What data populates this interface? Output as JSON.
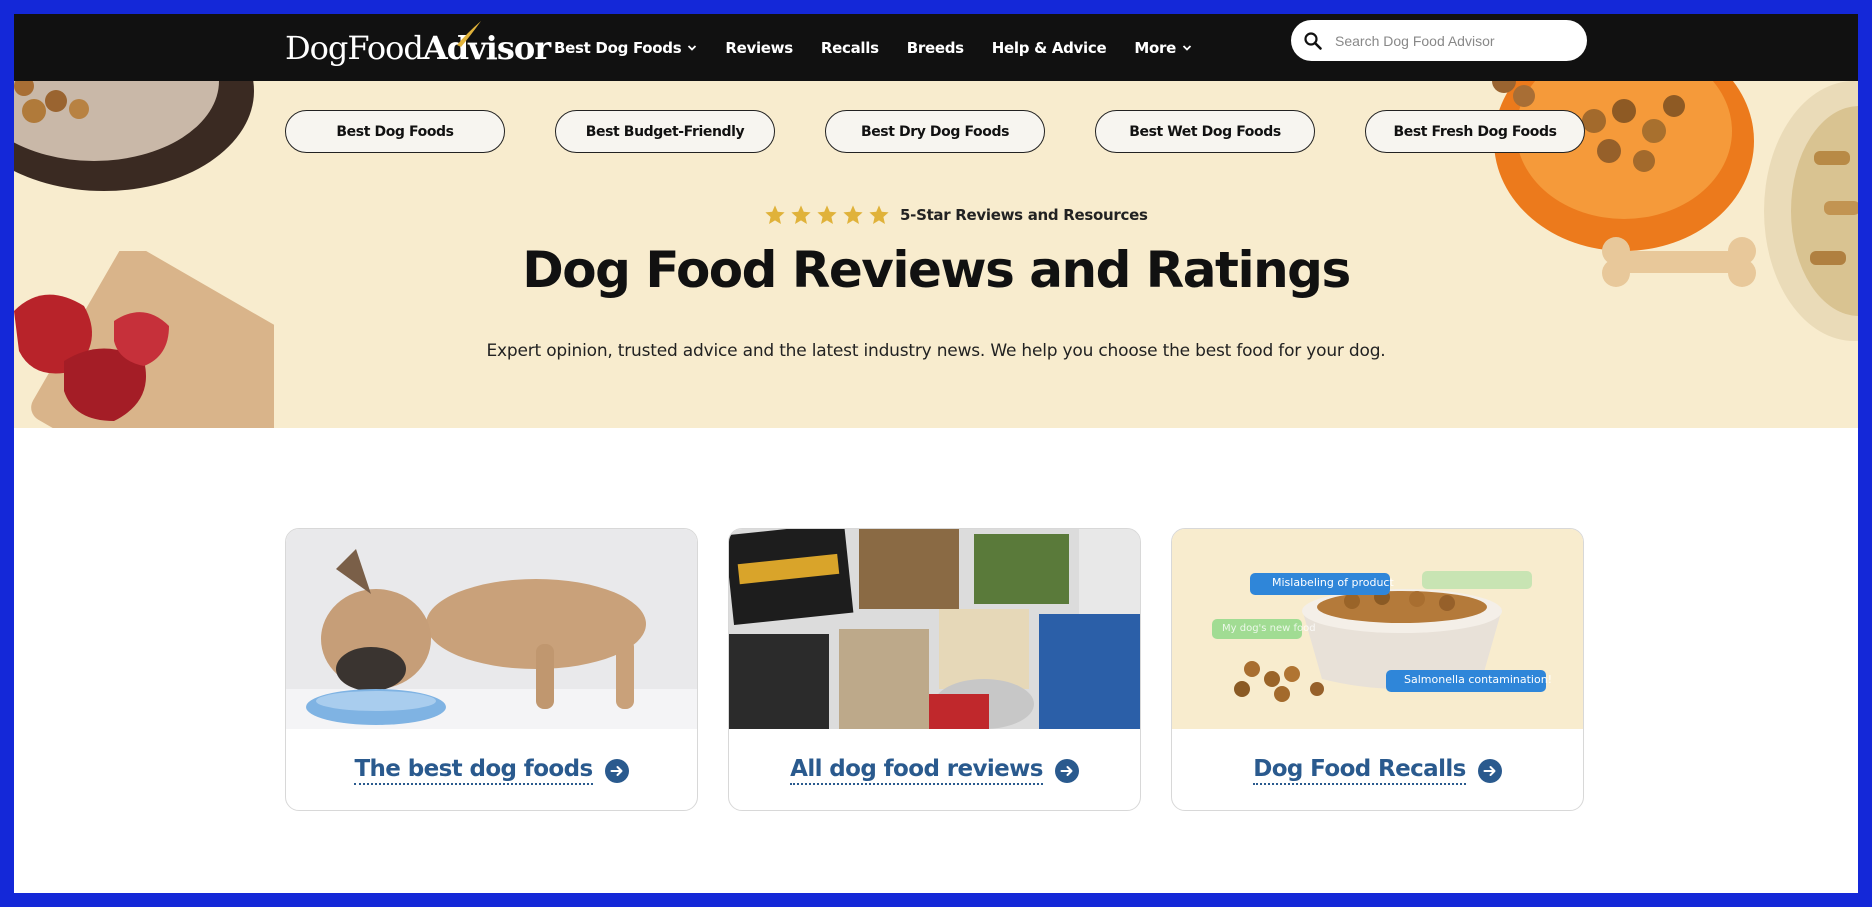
{
  "nav": {
    "logo": {
      "part1": "DogFood",
      "part2": "Advisor"
    },
    "items": [
      {
        "label": "Best Dog Foods",
        "dropdown": true
      },
      {
        "label": "Reviews",
        "dropdown": false
      },
      {
        "label": "Recalls",
        "dropdown": false
      },
      {
        "label": "Breeds",
        "dropdown": false
      },
      {
        "label": "Help & Advice",
        "dropdown": false
      },
      {
        "label": "More",
        "dropdown": true
      }
    ],
    "search_placeholder": "Search Dog Food Advisor"
  },
  "hero": {
    "pills": [
      "Best Dog Foods",
      "Best Budget-Friendly",
      "Best Dry Dog Foods",
      "Best Wet Dog Foods",
      "Best Fresh Dog Foods"
    ],
    "star_count": 5,
    "rating_text": "5-Star Reviews and Resources",
    "title": "Dog Food Reviews and Ratings",
    "subtitle": "Expert opinion, trusted advice and the latest industry news. We help you choose the best food for your dog."
  },
  "cards": [
    {
      "label": "The best dog foods",
      "image": "dog-eating-from-bowl"
    },
    {
      "label": "All dog food reviews",
      "image": "dog-food-packages"
    },
    {
      "label": "Dog Food Recalls",
      "image": "kibble-bowl-with-alerts",
      "alerts": [
        "Mislabeling of product",
        "Salmonella contamination!",
        "My dog's new food"
      ]
    }
  ],
  "colors": {
    "frame_border": "#1428d8",
    "nav_bg": "#111111",
    "hero_bg": "#f8ecce",
    "star": "#e0b23a",
    "link": "#2a5a8e"
  }
}
